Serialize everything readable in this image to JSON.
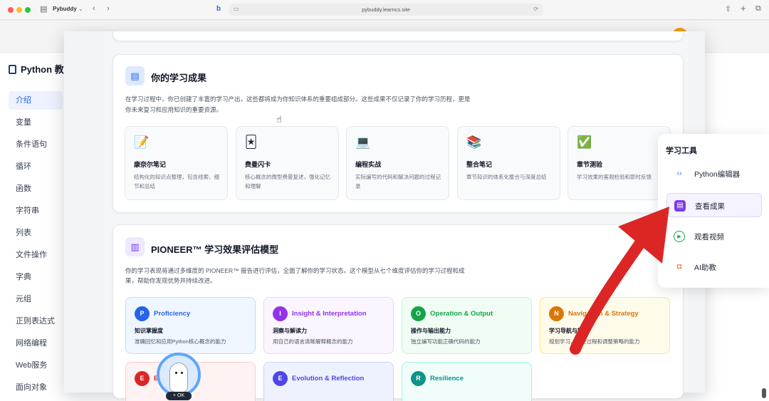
{
  "browser": {
    "tab_title": "Pybuddy",
    "url": "pybuddy.learncs.site"
  },
  "sidebar": {
    "brand": "Python 教",
    "items": [
      {
        "label": "介绍",
        "active": true
      },
      {
        "label": "变量"
      },
      {
        "label": "条件语句"
      },
      {
        "label": "循环"
      },
      {
        "label": "函数"
      },
      {
        "label": "字符串"
      },
      {
        "label": "列表"
      },
      {
        "label": "文件操作"
      },
      {
        "label": "字典"
      },
      {
        "label": "元组"
      },
      {
        "label": "正则表达式"
      },
      {
        "label": "网络编程"
      },
      {
        "label": "Web服务"
      },
      {
        "label": "面向对象"
      }
    ]
  },
  "results": {
    "title": "你的学习成果",
    "desc_line1": "在学习过程中，你已创建了丰富的学习产出，这些都将成为你知识体系的重要组成部分。这些成果不仅记录了你的学习历程，更是",
    "desc_line2": "你未来复习和应用知识的重要资源。",
    "tiles": [
      {
        "emoji": "📝",
        "title": "康奈尔笔记",
        "desc": "结构化的知识点整理，包含线索、细节和总结"
      },
      {
        "emoji": "🃏",
        "title": "费曼闪卡",
        "desc": "核心概念的微型费曼复述，强化记忆和理解"
      },
      {
        "emoji": "💻",
        "title": "编程实战",
        "desc": "实际编写的代码和解决问题的过程记录"
      },
      {
        "emoji": "📚",
        "title": "整合笔记",
        "desc": "章节知识的体系化整合与深度总结"
      },
      {
        "emoji": "✅",
        "title": "章节测验",
        "desc": "学习效果的客观检验和即时反馈"
      }
    ]
  },
  "pioneer": {
    "title": "PIONEER™ 学习效果评估模型",
    "desc_line1": "你的学习表现将通过多维度的 PIONEER™ 报告进行评估，全面了解你的学习状态。这个模型从七个维度评估你的学习过程和成",
    "desc_line2": "果，帮助你发现优势并持续改进。",
    "boxes": [
      {
        "letter": "P",
        "title": "Proficiency",
        "sub": "知识掌握度",
        "desc": "准确回忆和应用Python核心概念的能力",
        "color": "#2563eb",
        "bg": "#eff6ff",
        "border": "#bfdbfe"
      },
      {
        "letter": "I",
        "title": "Insight & Interpretation",
        "sub": "洞察与解读力",
        "desc": "用自己的语言清晰解释概念的能力",
        "color": "#9333ea",
        "bg": "#faf5ff",
        "border": "#e9d5ff"
      },
      {
        "letter": "O",
        "title": "Operation & Output",
        "sub": "操作与输出能力",
        "desc": "独立编写功能正确代码的能力",
        "color": "#16a34a",
        "bg": "#f0fdf4",
        "border": "#bbf7d0"
      },
      {
        "letter": "N",
        "title": "Navigation & Strategy",
        "sub": "学习导航与策略",
        "desc": "规划学习、监控过程和调整策略的能力",
        "color": "#d97706",
        "bg": "#fffbeb",
        "border": "#fde68a"
      },
      {
        "letter": "E",
        "title": "Effort",
        "sub": "",
        "desc": "",
        "color": "#dc2626",
        "bg": "#fef2f2",
        "border": "#fecaca"
      },
      {
        "letter": "E",
        "title": "Evolution & Reflection",
        "sub": "",
        "desc": "",
        "color": "#4f46e5",
        "bg": "#eef2ff",
        "border": "#c7d2fe"
      },
      {
        "letter": "R",
        "title": "Resilience",
        "sub": "",
        "desc": "",
        "color": "#0d9488",
        "bg": "#f0fdfa",
        "border": "#99f6e4"
      }
    ]
  },
  "tools": {
    "title": "学习工具",
    "items": [
      {
        "label": "Python编辑器",
        "icon": "code-icon"
      },
      {
        "label": "查看成果",
        "icon": "document-icon",
        "active": true
      },
      {
        "label": "观看视频",
        "icon": "play-icon"
      },
      {
        "label": "AI助教",
        "icon": "robot-icon"
      }
    ]
  },
  "mascot": {
    "badge": "OK"
  }
}
